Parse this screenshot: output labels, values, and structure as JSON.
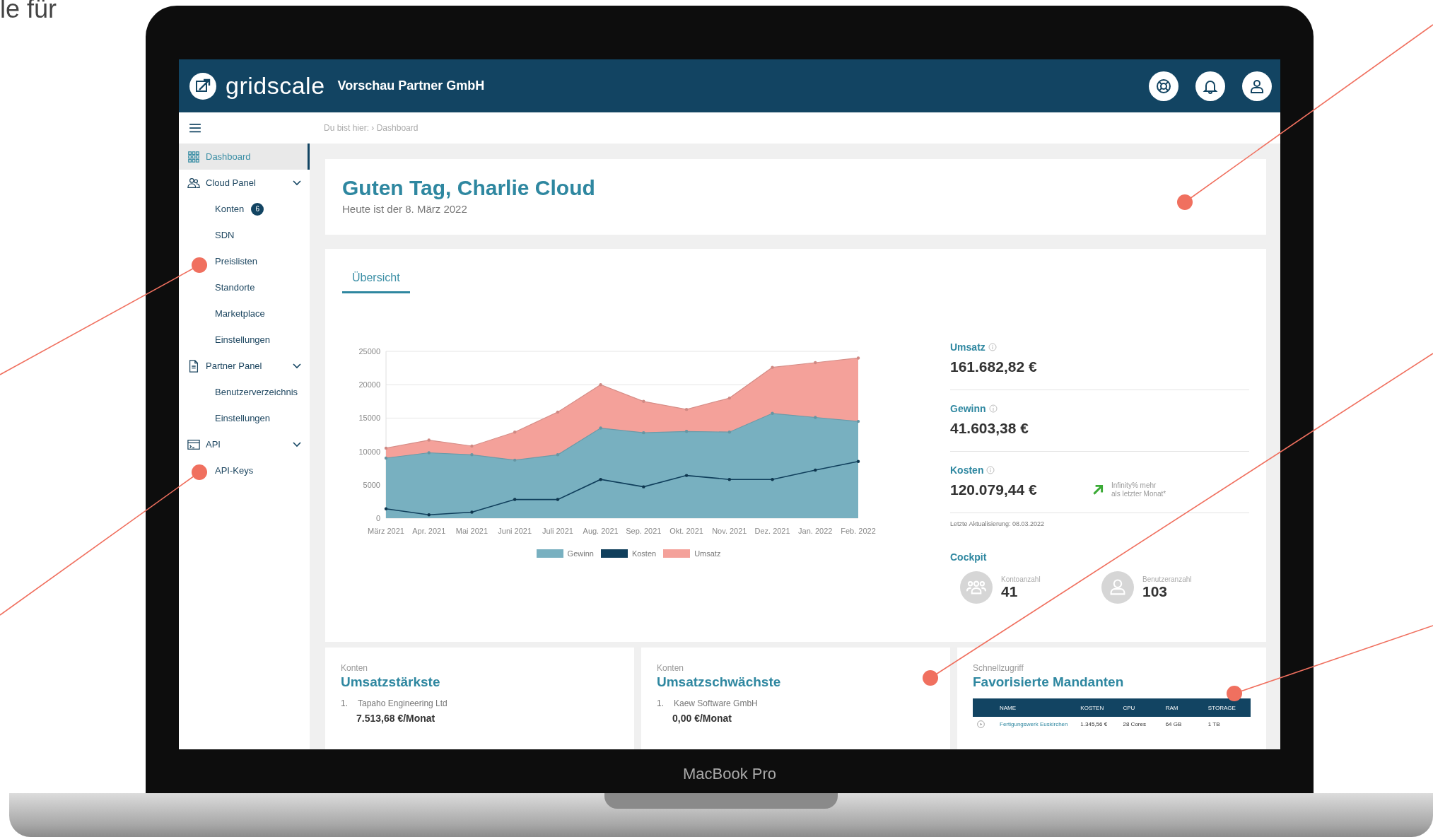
{
  "page_fragment": "le für",
  "header": {
    "brand": "gridscale",
    "company": "Vorschau Partner GmbH"
  },
  "breadcrumb": {
    "prefix": "Du bist hier:",
    "separator": "›",
    "current": "Dashboard"
  },
  "sidebar": {
    "items": [
      {
        "label": "Dashboard",
        "selected": true
      },
      {
        "label": "Cloud Panel",
        "selected": false,
        "expanded": true,
        "children": [
          {
            "label": "Konten",
            "badge": "6",
            "selected": false
          },
          {
            "label": "SDN",
            "selected": false
          },
          {
            "label": "Preislisten",
            "selected": false
          },
          {
            "label": "Standorte",
            "selected": false
          },
          {
            "label": "Marketplace",
            "selected": false
          },
          {
            "label": "Einstellungen",
            "selected": false
          }
        ]
      },
      {
        "label": "Partner Panel",
        "selected": false,
        "expanded": true,
        "children": [
          {
            "label": "Benutzerverzeichnis",
            "selected": false
          },
          {
            "label": "Einstellungen",
            "selected": false
          }
        ]
      },
      {
        "label": "API",
        "selected": false,
        "expanded": true,
        "children": [
          {
            "label": "API-Keys",
            "selected": false
          }
        ]
      }
    ]
  },
  "greeting": {
    "title": "Guten Tag, Charlie Cloud",
    "subtitle": "Heute ist der 8. März 2022"
  },
  "overview": {
    "tabs": [
      {
        "label": "Übersicht",
        "selected": true
      }
    ],
    "chart_data": {
      "type": "area",
      "categories": [
        "März 2021",
        "Apr. 2021",
        "Mai 2021",
        "Juni 2021",
        "Juli 2021",
        "Aug. 2021",
        "Sep. 2021",
        "Okt. 2021",
        "Nov. 2021",
        "Dez. 2021",
        "Jan. 2022",
        "Feb. 2022"
      ],
      "ylim": [
        0,
        25000
      ],
      "legend": "bottom",
      "yticks": [
        0,
        5000,
        10000,
        15000,
        20000,
        25000
      ],
      "series": [
        {
          "name": "Gewinn",
          "color": "#78b0c0",
          "type": "area",
          "values": [
            9000,
            9800,
            9500,
            8700,
            9500,
            13500,
            12800,
            13000,
            12900,
            15700,
            15100,
            14500
          ]
        },
        {
          "name": "Kosten",
          "color": "#103f5c",
          "type": "line",
          "values": [
            1400,
            500,
            900,
            2800,
            2800,
            5800,
            4700,
            6400,
            5800,
            5800,
            7200,
            8500
          ]
        },
        {
          "name": "Umsatz",
          "color": "#f4a19a",
          "type": "area",
          "values": [
            10500,
            11700,
            10800,
            12900,
            15900,
            20000,
            17500,
            16300,
            18000,
            22600,
            23300,
            24000
          ]
        }
      ]
    },
    "stats": [
      {
        "label": "Umsatz",
        "value": "161.682,82 €"
      },
      {
        "label": "Gewinn",
        "value": "41.603,38 €"
      },
      {
        "label": "Kosten",
        "value": "120.079,44 €",
        "trend": [
          "Infinity% mehr",
          "als letzter Monat*"
        ]
      }
    ],
    "updated": "Letzte Aktualisierung: 08.03.2022",
    "cockpit": {
      "title": "Cockpit",
      "items": [
        {
          "label": "Kontoanzahl",
          "value": "41"
        },
        {
          "label": "Benutzeranzahl",
          "value": "103"
        }
      ]
    }
  },
  "cards": [
    {
      "kicker": "Konten",
      "title": "Umsatzstärkste",
      "entries": [
        {
          "rank": "1.",
          "name": "Tapaho Engineering Ltd",
          "amount": "7.513,68 €/Monat"
        }
      ]
    },
    {
      "kicker": "Konten",
      "title": "Umsatzschwächste",
      "entries": [
        {
          "rank": "1.",
          "name": "Kaew Software GmbH",
          "amount": "0,00 €/Monat"
        }
      ]
    },
    {
      "kicker": "Schnellzugriff",
      "title": "Favorisierte Mandanten",
      "table": {
        "columns": [
          "NAME",
          "KOSTEN",
          "CPU",
          "RAM",
          "STORAGE"
        ],
        "rows": [
          [
            "Fertigungswerk Euskirchen",
            "1.345,56 €",
            "28 Cores",
            "64 GB",
            "1 TB"
          ]
        ]
      }
    }
  ],
  "device_label": "MacBook Pro"
}
